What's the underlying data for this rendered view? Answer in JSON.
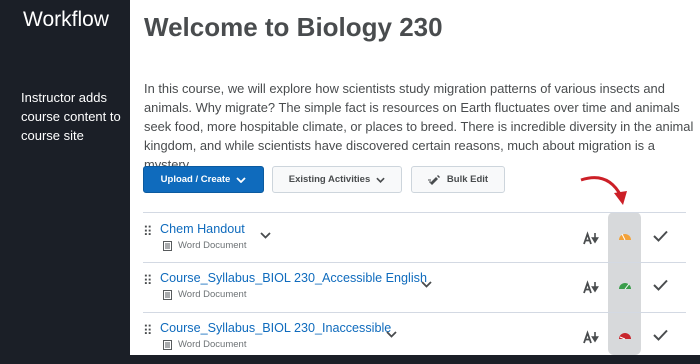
{
  "sidebar": {
    "title": "Workflow",
    "description": "Instructor adds course content to course site"
  },
  "course": {
    "title": "Welcome to Biology 230",
    "intro": "In this course, we will explore how scientists study migration patterns of various insects and animals. Why migrate? The simple fact is resources on Earth fluctuates over time and animals seek food, more hospitable climate, or places to breed. There is incredible diversity in the animal kingdom, and while scientists have discovered certain reasons, much about migration is a mystery."
  },
  "toolbar": {
    "upload_label": "Upload / Create",
    "existing_label": "Existing Activities",
    "bulk_label": "Bulk Edit"
  },
  "items": [
    {
      "title": "Chem Handout",
      "type": "Word Document",
      "accessibility": "orange",
      "accessibility_color": "#f2a23a"
    },
    {
      "title": "Course_Syllabus_BIOL 230_Accessible English",
      "type": "Word Document",
      "accessibility": "green",
      "accessibility_color": "#3a9d4b"
    },
    {
      "title": "Course_Syllabus_BIOL 230_Inaccessible",
      "type": "Word Document",
      "accessibility": "red",
      "accessibility_color": "#c8262d"
    }
  ],
  "icons": {
    "grip": "drag-handle-icon",
    "document": "document-icon",
    "chevron": "chevron-down-icon",
    "alt": "alternative-formats-icon",
    "meter": "accessibility-gauge-icon",
    "check": "checkmark-icon",
    "arrow": "curved-arrow-icon"
  },
  "colors": {
    "background": "#1b1f27",
    "primary": "#0f6bbd",
    "arrow": "#cc1f27",
    "highlight": "#d7d9db"
  }
}
